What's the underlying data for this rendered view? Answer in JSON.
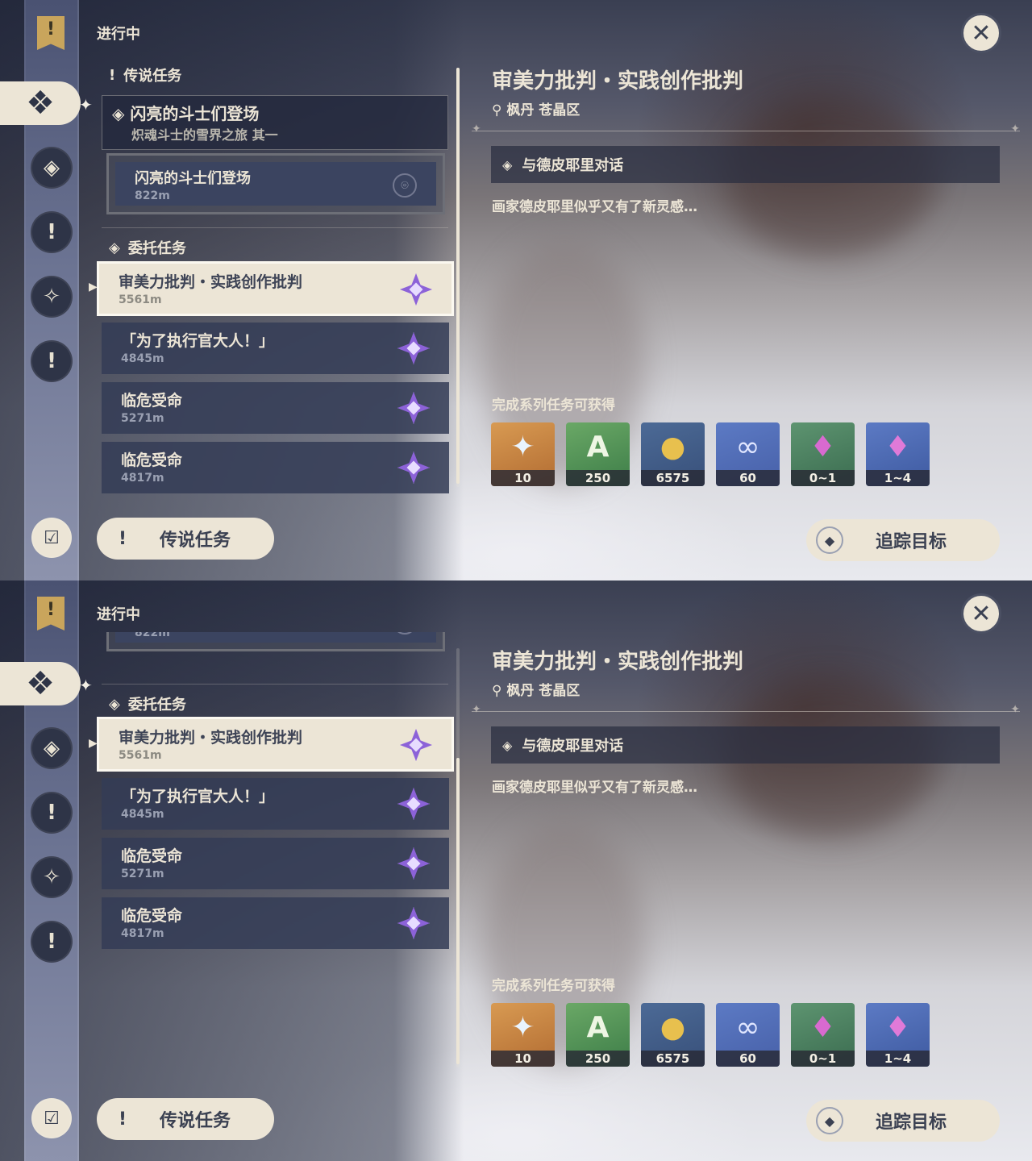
{
  "header": {
    "status_label": "进行中"
  },
  "sections": {
    "legend": "传说任务",
    "commission": "委托任务"
  },
  "legend_quest": {
    "title": "闪亮的斗士们登场",
    "subtitle": "炽魂斗士的雪界之旅 其一",
    "step": {
      "title": "闪亮的斗士们登场",
      "distance": "822m"
    }
  },
  "commissions": [
    {
      "title": "审美力批判・实践创作批判",
      "distance": "5561m"
    },
    {
      "title": "「为了执行官大人！」",
      "distance": "4845m"
    },
    {
      "title": "临危受命",
      "distance": "5271m"
    },
    {
      "title": "临危受命",
      "distance": "4817m"
    }
  ],
  "detail": {
    "title": "审美力批判・实践创作批判",
    "location": "枫丹 苍晶区",
    "objective": "与德皮耶里对话",
    "description": "画家德皮耶里似乎又有了新灵感…",
    "rewards_label": "完成系列任务可获得",
    "rewards": [
      {
        "icon": "primogem-icon",
        "count": "10"
      },
      {
        "icon": "adventure-exp-icon",
        "count": "250"
      },
      {
        "icon": "mora-icon",
        "count": "6575"
      },
      {
        "icon": "companionship-exp-icon",
        "count": "60"
      },
      {
        "icon": "crystal-chunk-icon",
        "count": "0~1"
      },
      {
        "icon": "crystal-cluster-icon",
        "count": "1~4"
      }
    ]
  },
  "buttons": {
    "legend_filter": "传说任务",
    "track": "追踪目标"
  },
  "colors": {
    "cream": "#ece5d6",
    "panel": "#343c56",
    "accent_star": "#8c62d8"
  }
}
